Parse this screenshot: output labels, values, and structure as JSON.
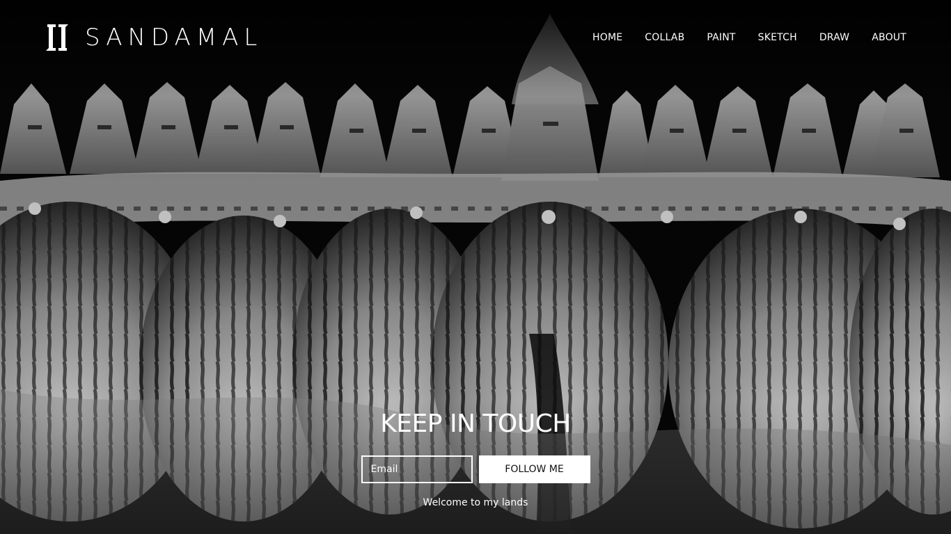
{
  "brand": {
    "name": "SANDAMAL",
    "logo_icon": "sandamal-monogram-icon"
  },
  "nav": {
    "items": [
      {
        "label": "HOME"
      },
      {
        "label": "COLLAB"
      },
      {
        "label": "PAINT"
      },
      {
        "label": "SKETCH"
      },
      {
        "label": "DRAW"
      },
      {
        "label": "ABOUT"
      }
    ]
  },
  "hero": {
    "title": "KEEP IN TOUCH",
    "email_placeholder": "Email",
    "email_value": "",
    "follow_label": "FOLLOW ME",
    "note": "Welcome to my lands"
  },
  "colors": {
    "text": "#ffffff",
    "button_bg": "#ffffff",
    "button_text": "#111111",
    "background": "#050505"
  }
}
